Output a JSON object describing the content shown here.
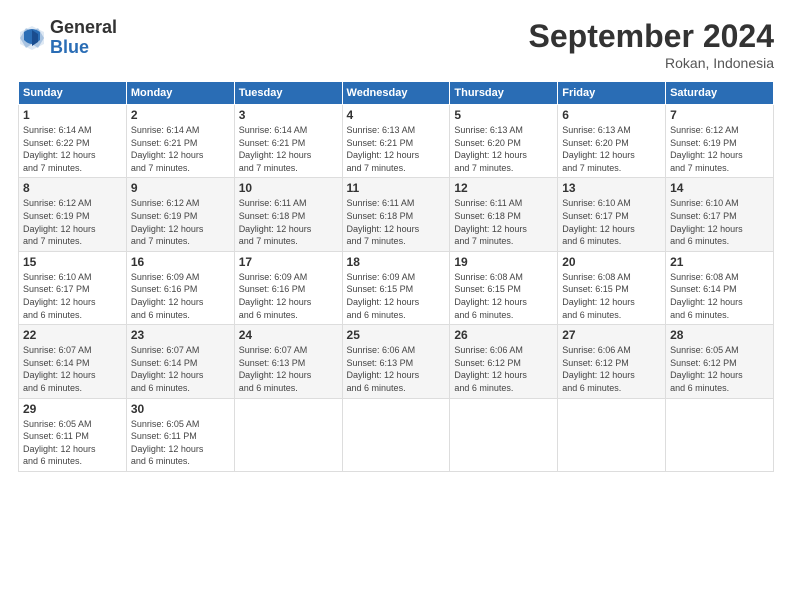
{
  "logo": {
    "general": "General",
    "blue": "Blue"
  },
  "title": "September 2024",
  "subtitle": "Rokan, Indonesia",
  "days_of_week": [
    "Sunday",
    "Monday",
    "Tuesday",
    "Wednesday",
    "Thursday",
    "Friday",
    "Saturday"
  ],
  "weeks": [
    [
      {
        "day": "1",
        "info": "Sunrise: 6:14 AM\nSunset: 6:22 PM\nDaylight: 12 hours\nand 7 minutes."
      },
      {
        "day": "2",
        "info": "Sunrise: 6:14 AM\nSunset: 6:21 PM\nDaylight: 12 hours\nand 7 minutes."
      },
      {
        "day": "3",
        "info": "Sunrise: 6:14 AM\nSunset: 6:21 PM\nDaylight: 12 hours\nand 7 minutes."
      },
      {
        "day": "4",
        "info": "Sunrise: 6:13 AM\nSunset: 6:21 PM\nDaylight: 12 hours\nand 7 minutes."
      },
      {
        "day": "5",
        "info": "Sunrise: 6:13 AM\nSunset: 6:20 PM\nDaylight: 12 hours\nand 7 minutes."
      },
      {
        "day": "6",
        "info": "Sunrise: 6:13 AM\nSunset: 6:20 PM\nDaylight: 12 hours\nand 7 minutes."
      },
      {
        "day": "7",
        "info": "Sunrise: 6:12 AM\nSunset: 6:19 PM\nDaylight: 12 hours\nand 7 minutes."
      }
    ],
    [
      {
        "day": "8",
        "info": "Sunrise: 6:12 AM\nSunset: 6:19 PM\nDaylight: 12 hours\nand 7 minutes."
      },
      {
        "day": "9",
        "info": "Sunrise: 6:12 AM\nSunset: 6:19 PM\nDaylight: 12 hours\nand 7 minutes."
      },
      {
        "day": "10",
        "info": "Sunrise: 6:11 AM\nSunset: 6:18 PM\nDaylight: 12 hours\nand 7 minutes."
      },
      {
        "day": "11",
        "info": "Sunrise: 6:11 AM\nSunset: 6:18 PM\nDaylight: 12 hours\nand 7 minutes."
      },
      {
        "day": "12",
        "info": "Sunrise: 6:11 AM\nSunset: 6:18 PM\nDaylight: 12 hours\nand 7 minutes."
      },
      {
        "day": "13",
        "info": "Sunrise: 6:10 AM\nSunset: 6:17 PM\nDaylight: 12 hours\nand 6 minutes."
      },
      {
        "day": "14",
        "info": "Sunrise: 6:10 AM\nSunset: 6:17 PM\nDaylight: 12 hours\nand 6 minutes."
      }
    ],
    [
      {
        "day": "15",
        "info": "Sunrise: 6:10 AM\nSunset: 6:17 PM\nDaylight: 12 hours\nand 6 minutes."
      },
      {
        "day": "16",
        "info": "Sunrise: 6:09 AM\nSunset: 6:16 PM\nDaylight: 12 hours\nand 6 minutes."
      },
      {
        "day": "17",
        "info": "Sunrise: 6:09 AM\nSunset: 6:16 PM\nDaylight: 12 hours\nand 6 minutes."
      },
      {
        "day": "18",
        "info": "Sunrise: 6:09 AM\nSunset: 6:15 PM\nDaylight: 12 hours\nand 6 minutes."
      },
      {
        "day": "19",
        "info": "Sunrise: 6:08 AM\nSunset: 6:15 PM\nDaylight: 12 hours\nand 6 minutes."
      },
      {
        "day": "20",
        "info": "Sunrise: 6:08 AM\nSunset: 6:15 PM\nDaylight: 12 hours\nand 6 minutes."
      },
      {
        "day": "21",
        "info": "Sunrise: 6:08 AM\nSunset: 6:14 PM\nDaylight: 12 hours\nand 6 minutes."
      }
    ],
    [
      {
        "day": "22",
        "info": "Sunrise: 6:07 AM\nSunset: 6:14 PM\nDaylight: 12 hours\nand 6 minutes."
      },
      {
        "day": "23",
        "info": "Sunrise: 6:07 AM\nSunset: 6:14 PM\nDaylight: 12 hours\nand 6 minutes."
      },
      {
        "day": "24",
        "info": "Sunrise: 6:07 AM\nSunset: 6:13 PM\nDaylight: 12 hours\nand 6 minutes."
      },
      {
        "day": "25",
        "info": "Sunrise: 6:06 AM\nSunset: 6:13 PM\nDaylight: 12 hours\nand 6 minutes."
      },
      {
        "day": "26",
        "info": "Sunrise: 6:06 AM\nSunset: 6:12 PM\nDaylight: 12 hours\nand 6 minutes."
      },
      {
        "day": "27",
        "info": "Sunrise: 6:06 AM\nSunset: 6:12 PM\nDaylight: 12 hours\nand 6 minutes."
      },
      {
        "day": "28",
        "info": "Sunrise: 6:05 AM\nSunset: 6:12 PM\nDaylight: 12 hours\nand 6 minutes."
      }
    ],
    [
      {
        "day": "29",
        "info": "Sunrise: 6:05 AM\nSunset: 6:11 PM\nDaylight: 12 hours\nand 6 minutes."
      },
      {
        "day": "30",
        "info": "Sunrise: 6:05 AM\nSunset: 6:11 PM\nDaylight: 12 hours\nand 6 minutes."
      },
      {
        "day": "",
        "info": ""
      },
      {
        "day": "",
        "info": ""
      },
      {
        "day": "",
        "info": ""
      },
      {
        "day": "",
        "info": ""
      },
      {
        "day": "",
        "info": ""
      }
    ]
  ]
}
